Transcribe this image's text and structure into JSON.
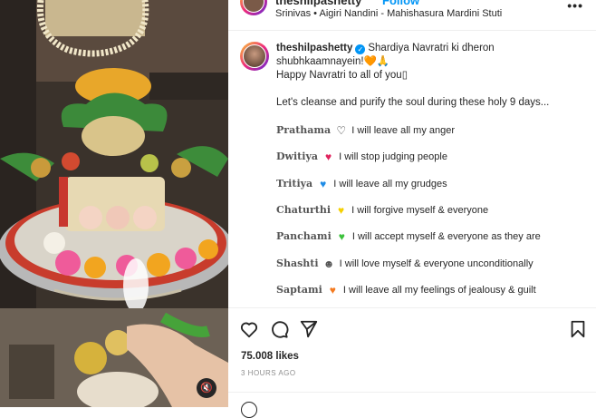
{
  "header": {
    "username": "theshilpashetty",
    "follow_label": "Follow",
    "song": "Srinivas • Aigiri Nandini - Mahishasura Mardini Stuti",
    "more_label": "•••"
  },
  "caption": {
    "username": "theshilpashetty",
    "verified_mark": "✓",
    "line1": "Shardiya Navratri ki dheron",
    "line2": "shubhkaamnayein!🧡🙏",
    "line3": "Happy Navratri to all of you▯",
    "line4": "Let's cleanse and purify the soul during these holy 9 days..."
  },
  "days": [
    {
      "name": "Prathama",
      "heart": "♡",
      "heart_color": "#262626",
      "text": "I will leave all my anger"
    },
    {
      "name": "Dwitiya",
      "heart": "♥",
      "heart_color": "#e0245e",
      "text": "I will stop judging people"
    },
    {
      "name": "Tritiya",
      "heart": "♥",
      "heart_color": "#1f8ce6",
      "text": "I will leave all my grudges"
    },
    {
      "name": "Chaturthi",
      "heart": "♥",
      "heart_color": "#f5d000",
      "text": "I will forgive myself & everyone"
    },
    {
      "name": "Panchami",
      "heart": "♥",
      "heart_color": "#3cc13b",
      "text": "I will accept myself & everyone as they are"
    },
    {
      "name": "Shashti",
      "heart": "☻",
      "heart_color": "#555555",
      "text": "I will love myself & everyone unconditionally"
    },
    {
      "name": "Saptami",
      "heart": "♥",
      "heart_color": "#f47a1f",
      "text": "I will leave all my feelings of jealousy & guilt"
    }
  ],
  "post": {
    "likes": "75.008 likes",
    "time": "3 HOURS AGO"
  },
  "media": {
    "mute_icon": "🔇"
  }
}
